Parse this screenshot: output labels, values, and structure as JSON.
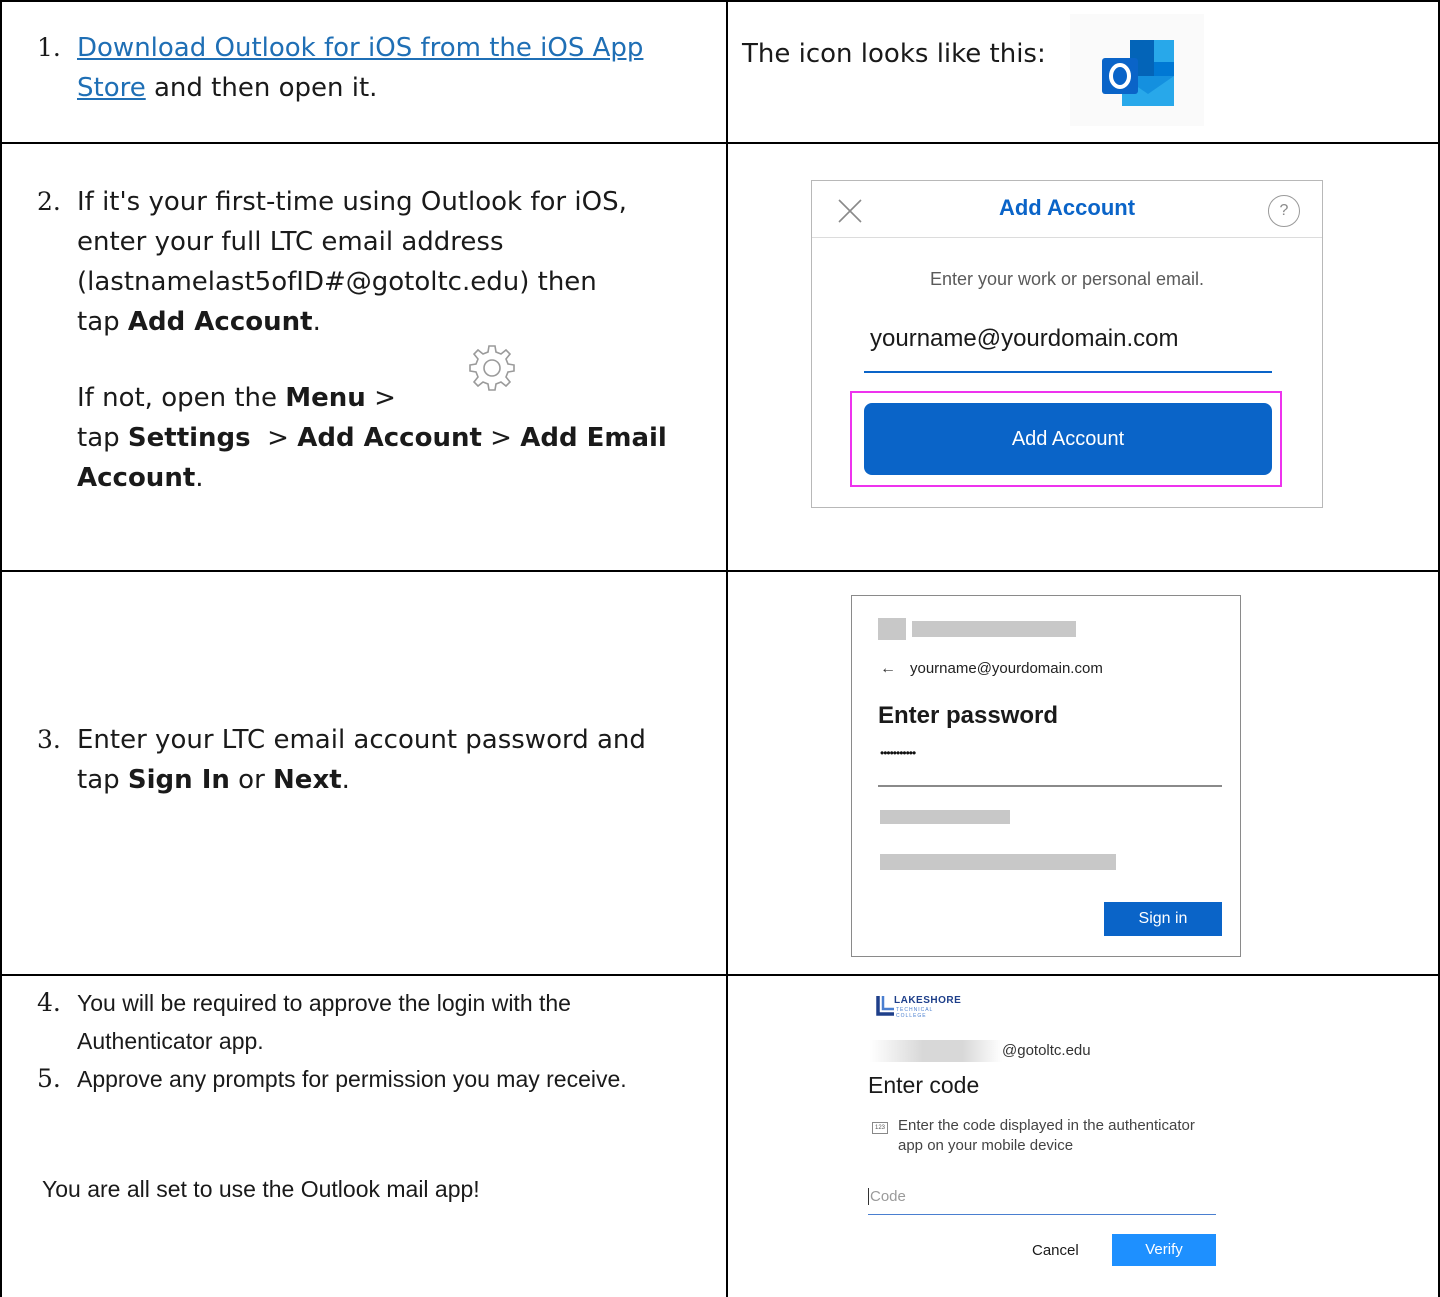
{
  "row1": {
    "num": "1.",
    "link": "Download Outlook for iOS from the iOS App Store",
    "rest": "and then open it.",
    "icon_caption": "The icon looks like this:"
  },
  "row2": {
    "num": "2.",
    "line1": "If it's your first-time using Outlook for iOS, enter your full LTC email address",
    "line2": "(lastnamelast5ofID#@gotoltc.edu) then",
    "tap": "tap",
    "add_account": "Add Account",
    "period": ".",
    "ifnot": "If not, open the",
    "menu": "Menu",
    "gt": ">",
    "tap2": "tap",
    "settings": "Settings",
    "add_email_account": "Add Email Account",
    "shot": {
      "title": "Add Account",
      "prompt": "Enter your work or personal email.",
      "email": "yourname@yourdomain.com",
      "button": "Add Account",
      "help": "?"
    }
  },
  "row3": {
    "num": "3.",
    "line1": "Enter your LTC email account password and",
    "tap": "tap",
    "sign_in": "Sign In",
    "or": "or",
    "next": "Next",
    "period": ".",
    "shot": {
      "back_email": "yourname@yourdomain.com",
      "heading": "Enter password",
      "password_mask": "•••••••••••",
      "button": "Sign in"
    }
  },
  "row4": {
    "num4": "4.",
    "step4": "You will be required to approve the login with the Authenticator app.",
    "num5": "5.",
    "step5": "Approve any prompts for permission you may receive.",
    "done": "You are all set to use the Outlook mail app!",
    "shot": {
      "logo_main": "LAKESHORE",
      "logo_sub1": "TECHNICAL",
      "logo_sub2": "COLLEGE",
      "domain": "@gotoltc.edu",
      "heading": "Enter code",
      "code_badge": "123",
      "instruction": "Enter the code displayed in the authenticator app on your mobile device",
      "placeholder": "Code",
      "cancel": "Cancel",
      "verify": "Verify"
    }
  },
  "colors": {
    "link": "#1f6fb5",
    "outlook_blue": "#0a64c8",
    "highlight": "#ee33ee",
    "verify_blue": "#1e90ff"
  }
}
